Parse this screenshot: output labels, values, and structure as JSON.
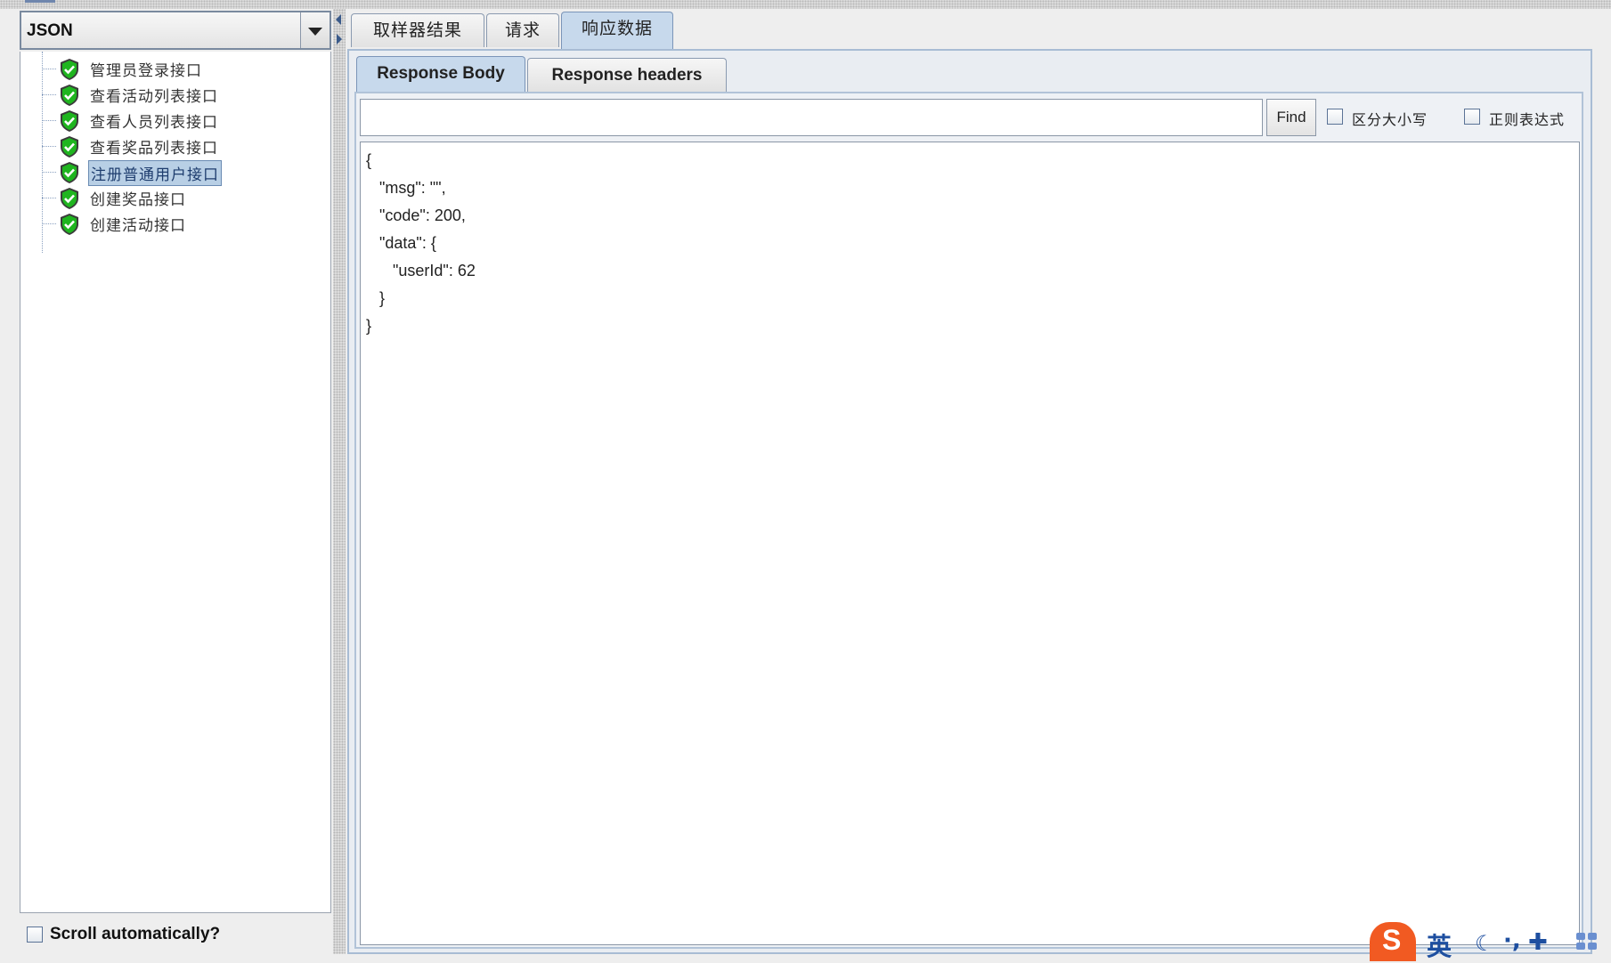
{
  "renderer_select": {
    "value": "JSON"
  },
  "tree": {
    "items": [
      {
        "label": "管理员登录接口"
      },
      {
        "label": "查看活动列表接口"
      },
      {
        "label": "查看人员列表接口"
      },
      {
        "label": "查看奖品列表接口"
      },
      {
        "label": "注册普通用户接口",
        "selected": true
      },
      {
        "label": "创建奖品接口"
      },
      {
        "label": "创建活动接口"
      }
    ],
    "status_icon": "green-shield-check-icon"
  },
  "scroll_auto": {
    "label": "Scroll automatically?",
    "checked": false
  },
  "main_tabs": [
    {
      "label": "取样器结果"
    },
    {
      "label": "请求"
    },
    {
      "label": "响应数据",
      "active": true
    }
  ],
  "sub_tabs": [
    {
      "label": "Response Body",
      "active": true
    },
    {
      "label": "Response headers"
    }
  ],
  "search": {
    "value": "",
    "find_label": "Find",
    "case_sensitive_label": "区分大小写",
    "case_sensitive_checked": false,
    "regex_label": "正则表达式",
    "regex_checked": false
  },
  "response_body": {
    "lines": [
      "{",
      "   \"msg\": \"\",",
      "   \"code\": 200,",
      "   \"data\": {",
      "      \"userId\": 62",
      "   }",
      "}"
    ]
  },
  "ime": {
    "logo_letter": "S",
    "mode_char": "英",
    "icons": [
      "moon-icon",
      "punctuation-icon",
      "skin-icon",
      "toolbox-grid-icon"
    ]
  }
}
